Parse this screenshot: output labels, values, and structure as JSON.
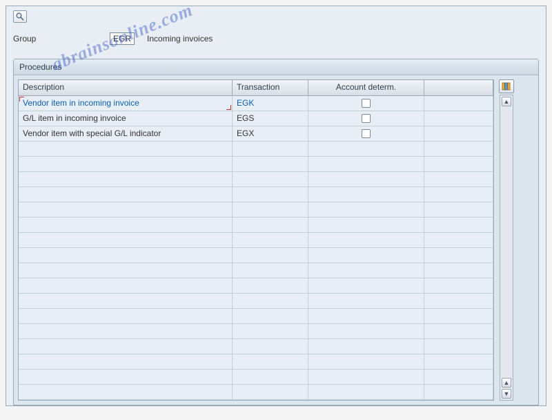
{
  "group": {
    "label": "Group",
    "value": "EGR",
    "desc": "Incoming invoices"
  },
  "procedures": {
    "title": "Procedures",
    "columns": {
      "desc": "Description",
      "trans": "Transaction",
      "acct": "Account determ."
    },
    "rows": [
      {
        "desc": "Vendor item in incoming invoice",
        "trans": "EGK",
        "acct": false,
        "highlight": true
      },
      {
        "desc": "G/L item in incoming invoice",
        "trans": "EGS",
        "acct": false,
        "highlight": false
      },
      {
        "desc": "Vendor item with special G/L indicator",
        "trans": "EGX",
        "acct": false,
        "highlight": false
      }
    ],
    "empty_rows": 17
  },
  "watermark": "abrainsonline.com"
}
